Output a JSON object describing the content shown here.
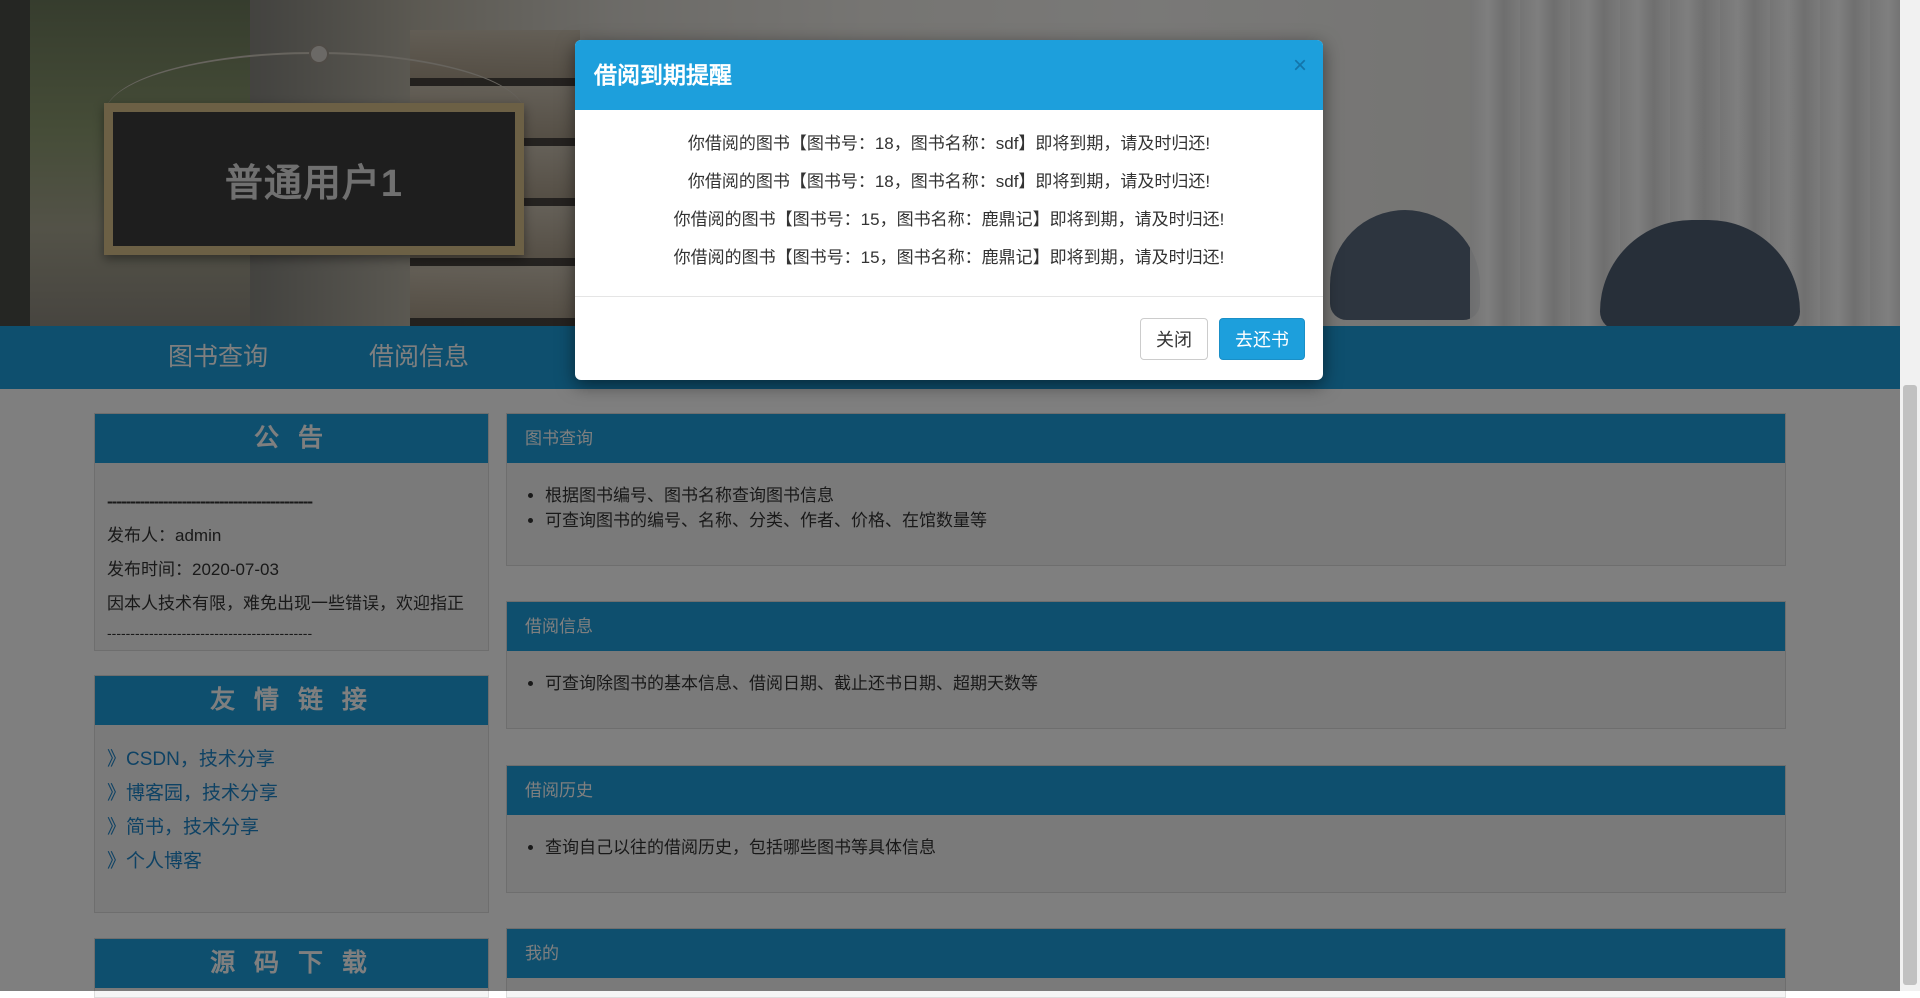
{
  "header": {
    "sign_text": "普通用户1"
  },
  "nav": {
    "items": [
      "图书查询",
      "借阅信息"
    ]
  },
  "sidebar": {
    "notice": {
      "title": "公 告",
      "divider_top": "--------------------------------------------",
      "publisher": "发布人：admin",
      "publish_time": "发布时间：2020-07-03",
      "content": "因本人技术有限，难免出现一些错误，欢迎指正",
      "divider_bottom": "--------------------------------------------"
    },
    "links": {
      "title": "友 情 链 接",
      "items": [
        "》CSDN，技术分享",
        "》博客园，技术分享",
        "》简书，技术分享",
        "》个人博客"
      ]
    },
    "download": {
      "title": "源 码 下 载"
    }
  },
  "main": {
    "panels": [
      {
        "title": "图书查询",
        "items": [
          "根据图书编号、图书名称查询图书信息",
          "可查询图书的编号、名称、分类、作者、价格、在馆数量等"
        ]
      },
      {
        "title": "借阅信息",
        "items": [
          "可查询除图书的基本信息、借阅日期、截止还书日期、超期天数等"
        ]
      },
      {
        "title": "借阅历史",
        "items": [
          "查询自己以往的借阅历史，包括哪些图书等具体信息"
        ]
      },
      {
        "title": "我的",
        "items": []
      }
    ]
  },
  "modal": {
    "title": "借阅到期提醒",
    "close_icon": "×",
    "messages": [
      "你借阅的图书【图书号：18，图书名称：sdf】即将到期，请及时归还!",
      "你借阅的图书【图书号：18，图书名称：sdf】即将到期，请及时归还!",
      "你借阅的图书【图书号：15，图书名称：鹿鼎记】即将到期，请及时归还!",
      "你借阅的图书【图书号：15，图书名称：鹿鼎记】即将到期，请及时归还!"
    ],
    "close_button": "关闭",
    "return_button": "去还书"
  },
  "colors": {
    "accent": "#1d9fdc",
    "link": "#1d84c9",
    "overlay": "rgba(0,0,0,0.5)"
  },
  "icons": {
    "modal_close": "close-icon"
  }
}
